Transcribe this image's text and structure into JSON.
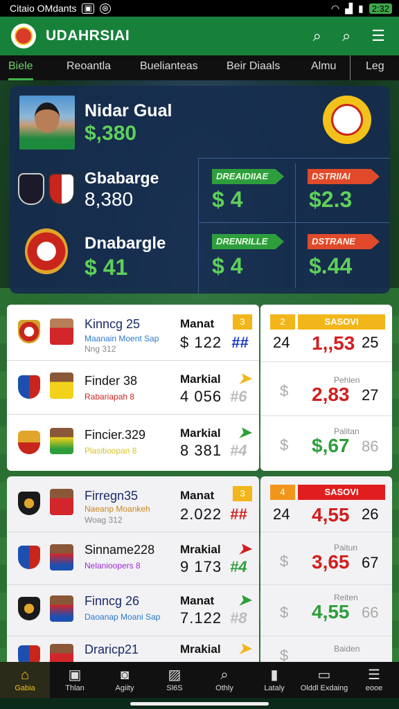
{
  "status": {
    "left_text": "Citaio OMdants",
    "clock": "2:32"
  },
  "app": {
    "title": "UDAHRSIAI"
  },
  "tabs": [
    {
      "label": "Biele"
    },
    {
      "label": "Reoantla"
    },
    {
      "label": "Buelianteas"
    },
    {
      "label": "Beir Diaals"
    },
    {
      "label": "Almu"
    },
    {
      "label": "Leg"
    }
  ],
  "hero": {
    "player_name": "Nidar Gual",
    "player_value": "$,380",
    "row1_name": "Gbabarge",
    "row1_value": "8,380",
    "row2_name": "Dnabargle",
    "row2_value": "$ 41",
    "badge1": "DREAIDIIAE",
    "badge2": "DSTRIIAI",
    "badge3": "DRENRILLE",
    "badge4": "DSTRANE",
    "val1": "$ 4",
    "val2": "$2.3",
    "val3": "$ 4",
    "val4": "$.44"
  },
  "card1": {
    "rows": [
      {
        "name": "Kinncg 25",
        "sub1": "Maanain Moent Sap",
        "sub2": "Nng 312",
        "mhead": "Manat",
        "mval": "$ 122",
        "mark": "##",
        "tag": "3",
        "odd1": "24",
        "odd_big": "1,,53",
        "odd2": "25",
        "top_tag_left": "2",
        "top_tag_right": "SASOVI"
      },
      {
        "name": "Finder 38",
        "sub1": "Rabariapah 8",
        "mhead": "Markial",
        "mval": "4 056",
        "mark": "#6",
        "label": "Pehlen",
        "odd_big": "2,83",
        "odd2": "27"
      },
      {
        "name": "Fincier.329",
        "sub1": "Plasitioopan 8",
        "mhead": "Markial",
        "mval": "8 381",
        "mark": "#4",
        "label": "Palitan",
        "odd_big": "$,67",
        "odd2": "86"
      }
    ]
  },
  "card2": {
    "rows": [
      {
        "name": "Firregn35",
        "sub1": "Naeanp Moankeh",
        "sub2": "Woag 312",
        "mhead": "Manat",
        "mval": "2.022",
        "mark": "##",
        "tag": "3",
        "odd1": "24",
        "odd_big": "4,55",
        "odd2": "26",
        "top_tag_left": "4",
        "top_tag_right": "SASOVI"
      },
      {
        "name": "Sinname228",
        "sub1": "Nelanioopers 8",
        "mhead": "Mrakial",
        "mval": "9 173",
        "mark": "#4",
        "label": "Paitun",
        "odd_big": "3,65",
        "odd2": "67"
      },
      {
        "name": "Finncg 26",
        "sub1": "Daoanap Moani Sap",
        "mhead": "Manat",
        "mval": "7.122",
        "mark": "#8",
        "label": "Reiten",
        "odd_big": "4,55",
        "odd2": "66"
      },
      {
        "name": "Draricp21",
        "mhead": "Mrakial",
        "label": "Baiden"
      }
    ]
  },
  "bottom_nav": [
    {
      "label": "Gabia",
      "icon": "home-icon"
    },
    {
      "label": "Thlan",
      "icon": "doc-icon"
    },
    {
      "label": "Agiity",
      "icon": "camera-icon"
    },
    {
      "label": "Sl6S",
      "icon": "chart-icon"
    },
    {
      "label": "Othly",
      "icon": "search-icon"
    },
    {
      "label": "Lataly",
      "icon": "pin-icon"
    },
    {
      "label": "Olddl Exdaing",
      "icon": "image-icon"
    },
    {
      "label": "eooe",
      "icon": "menu-icon"
    }
  ]
}
